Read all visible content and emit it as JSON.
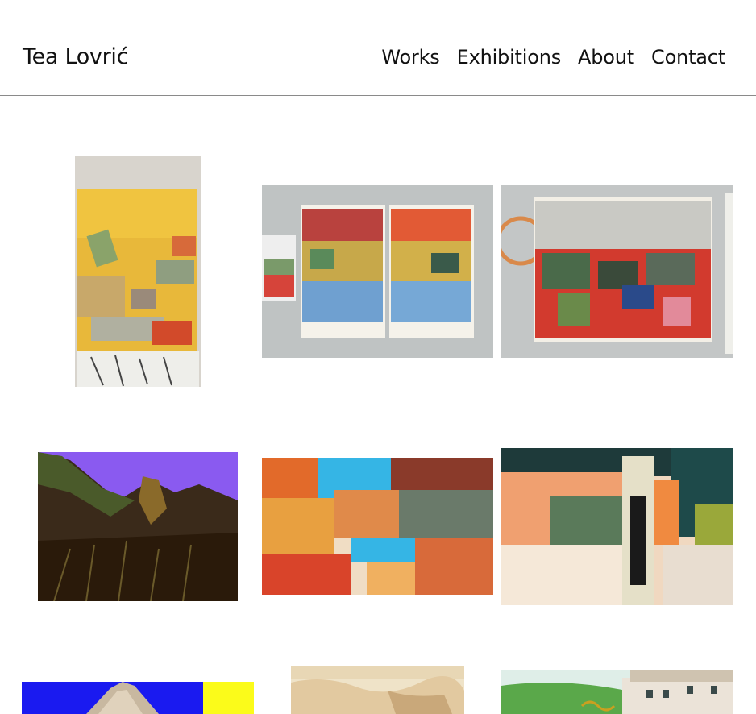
{
  "header": {
    "site_title": "Tea Lovrić",
    "nav": [
      "Works",
      "Exhibitions",
      "About",
      "Contact"
    ]
  },
  "gallery": {
    "items": [
      "yellow-abstract-portrait",
      "triptych-blue-red-on-wall",
      "red-green-drip-on-wall",
      "purple-sky-landscape",
      "orange-cyan-drip-abstract",
      "orange-collage-abstract",
      "blue-yellow-mountain",
      "beige-watercolor",
      "green-building-watercolor"
    ]
  },
  "colors": {
    "background": "#ffffff",
    "text": "#111111",
    "rule": "#8a8a8a"
  }
}
